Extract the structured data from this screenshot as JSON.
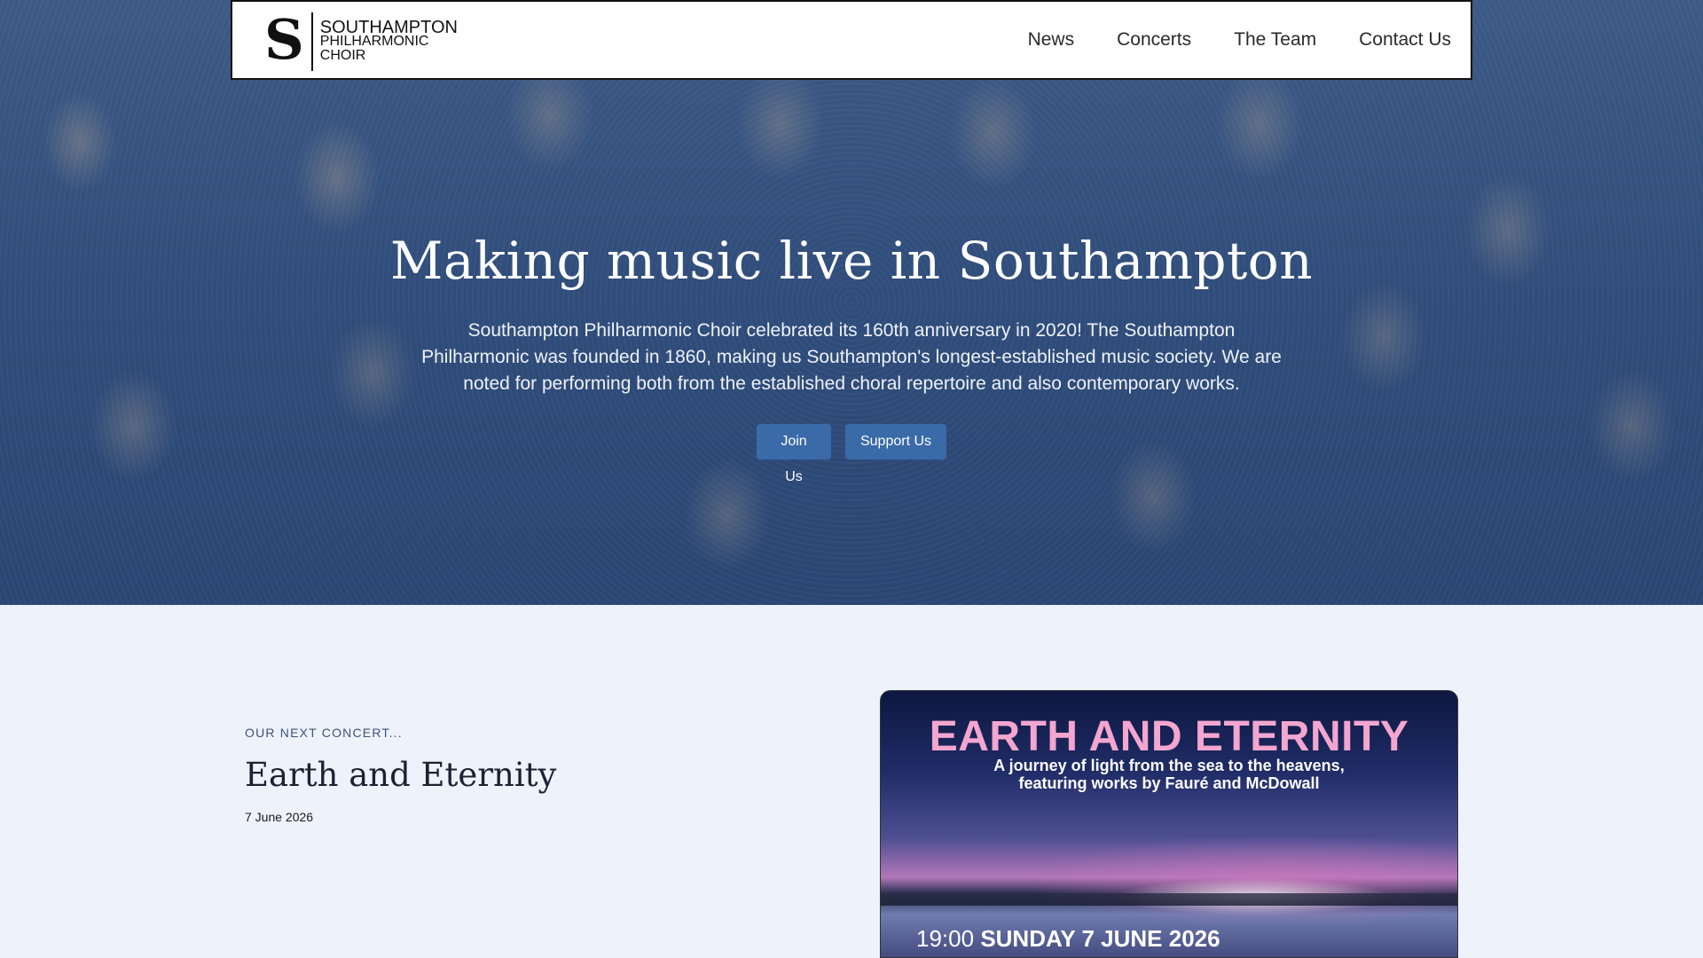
{
  "header": {
    "logo": {
      "letter": "S",
      "line1": "SOUTHAMPTON",
      "line2": "PHILHARMONIC",
      "line3": "CHOIR"
    },
    "nav": [
      {
        "label": "News"
      },
      {
        "label": "Concerts"
      },
      {
        "label": "The Team"
      },
      {
        "label": "Contact Us"
      }
    ]
  },
  "hero": {
    "title": "Making music live in Southampton",
    "text": "Southampton Philharmonic Choir celebrated its 160th anniversary in 2020! The Southampton Philharmonic was founded in 1860, making us Southampton's longest-established music society. We are noted for performing both from the established choral repertoire and also contemporary works.",
    "buttons": {
      "join": "Join Us",
      "support": "Support Us"
    }
  },
  "next_concert": {
    "eyebrow": "OUR NEXT CONCERT...",
    "title": "Earth and Eternity",
    "date": "7 June 2026"
  },
  "poster": {
    "title": "EARTH AND ETERNITY",
    "subtitle_line1": "A journey of light from the sea to the heavens,",
    "subtitle_line2": "featuring works by Fauré and McDowall",
    "time": "19:00",
    "date": "SUNDAY 7 JUNE 2026"
  },
  "colors": {
    "hero_overlay": "#2f4c7a",
    "button": "#3a6aa8",
    "page_bg": "#eef2fa",
    "poster_title": "#f3a6cf"
  }
}
